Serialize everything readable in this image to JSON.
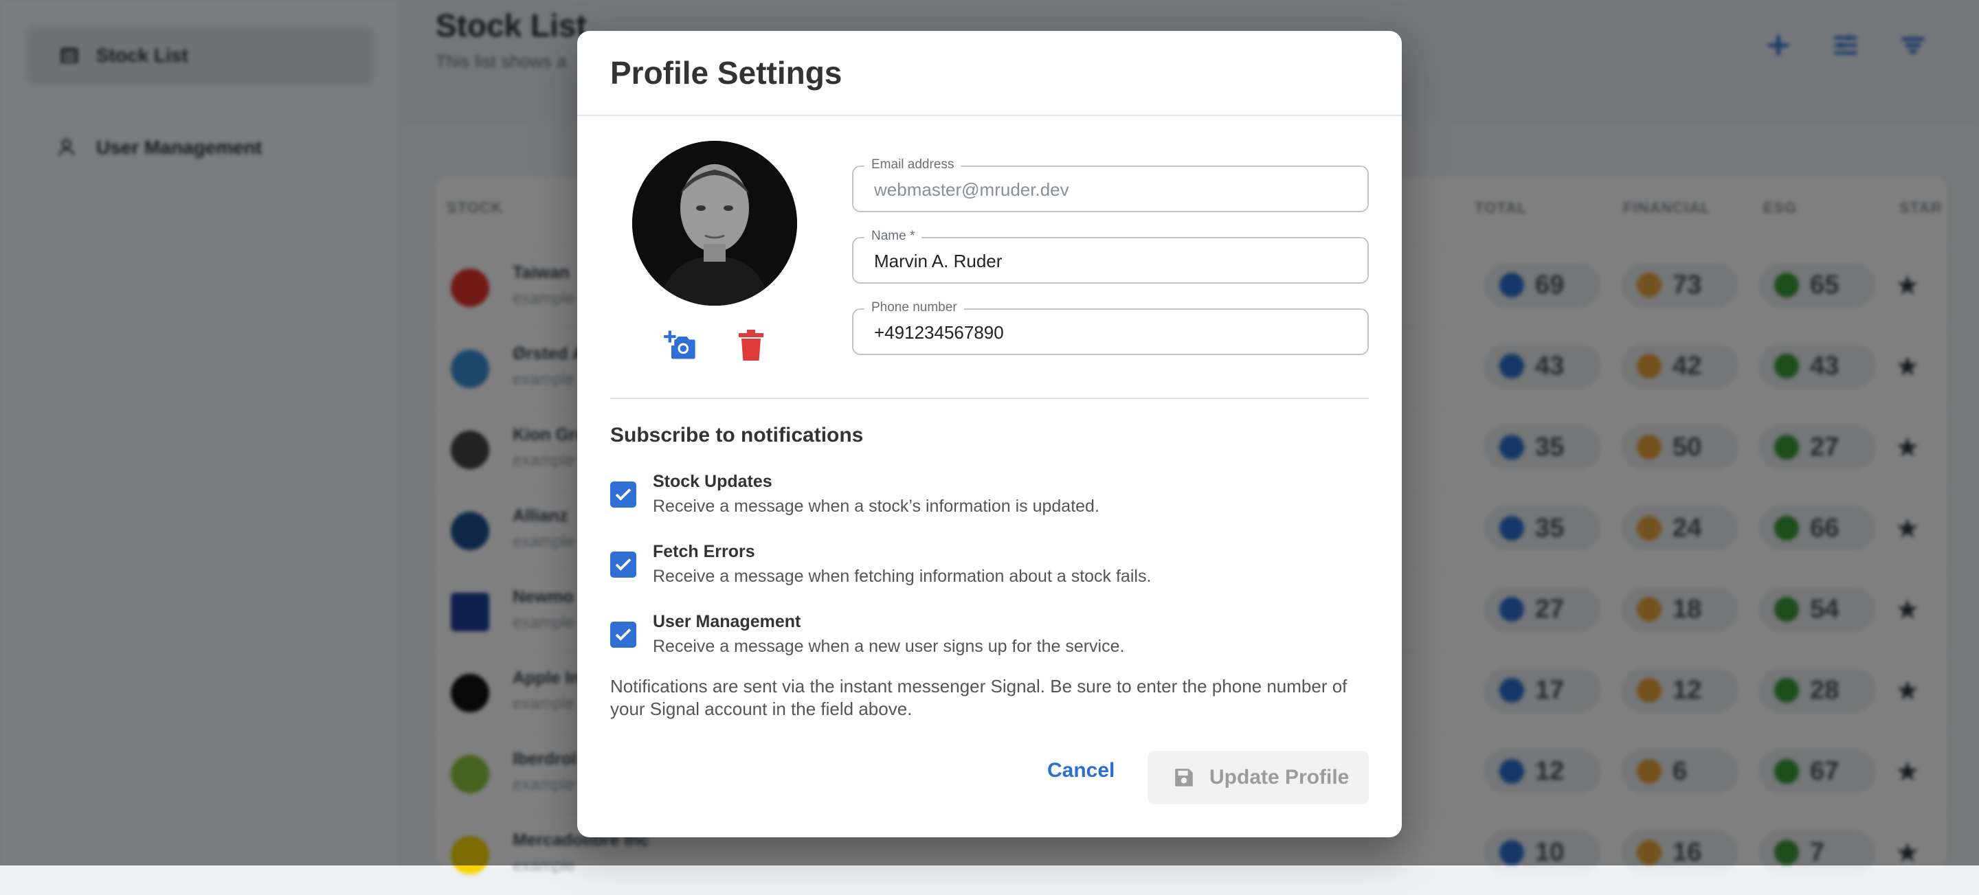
{
  "sidebar": {
    "items": [
      {
        "label": "Stock List",
        "icon": "list-icon",
        "active": true
      },
      {
        "label": "User Management",
        "icon": "users-icon",
        "active": false
      }
    ]
  },
  "main": {
    "title": "Stock List",
    "subtitle": "This list shows a",
    "header_icons": [
      "add-icon",
      "tune-icon",
      "filter-icon"
    ],
    "table": {
      "columns": [
        "STOCK",
        "TOTAL",
        "FINANCIAL",
        "ESG",
        "STAR"
      ],
      "rows": [
        {
          "name": "Taiwan ",
          "sub": "example",
          "total": 69,
          "financial": 73,
          "esg": 65
        },
        {
          "name": "Ørsted A",
          "sub": "example",
          "total": 43,
          "financial": 42,
          "esg": 43
        },
        {
          "name": "Kion Gro",
          "sub": "example",
          "total": 35,
          "financial": 50,
          "esg": 27
        },
        {
          "name": "Allianz ",
          "sub": "example",
          "total": 35,
          "financial": 24,
          "esg": 66
        },
        {
          "name": "Newmo",
          "sub": "example",
          "total": 27,
          "financial": 18,
          "esg": 54
        },
        {
          "name": "Apple In",
          "sub": "example",
          "total": 17,
          "financial": 12,
          "esg": 28
        },
        {
          "name": "Iberdrol",
          "sub": "example",
          "total": 12,
          "financial": 6,
          "esg": 67
        },
        {
          "name": "Mercadolibre Inc",
          "sub": "example",
          "total": 10,
          "financial": 16,
          "esg": 7
        }
      ]
    }
  },
  "dialog": {
    "title": "Profile Settings",
    "email": {
      "label": "Email address",
      "value": "webmaster@mruder.dev"
    },
    "name": {
      "label": "Name *",
      "value": "Marvin A. Ruder"
    },
    "phone": {
      "label": "Phone number",
      "value": "+491234567890"
    },
    "notifications_heading": "Subscribe to notifications",
    "options": [
      {
        "title": "Stock Updates",
        "description": "Receive a message when a stock’s information is updated.",
        "checked": true
      },
      {
        "title": "Fetch Errors",
        "description": "Receive a message when fetching information about a stock fails.",
        "checked": true
      },
      {
        "title": "User Management",
        "description": "Receive a message when a new user signs up for the service.",
        "checked": true
      }
    ],
    "note": "Notifications are sent via the instant messenger Signal. Be sure to enter the phone number of your Signal account in the field above.",
    "cancel_label": "Cancel",
    "update_label": "Update Profile",
    "colors": {
      "accent": "#2f6fd6",
      "delete": "#e03b3b",
      "link": "#2c6fd0"
    }
  }
}
